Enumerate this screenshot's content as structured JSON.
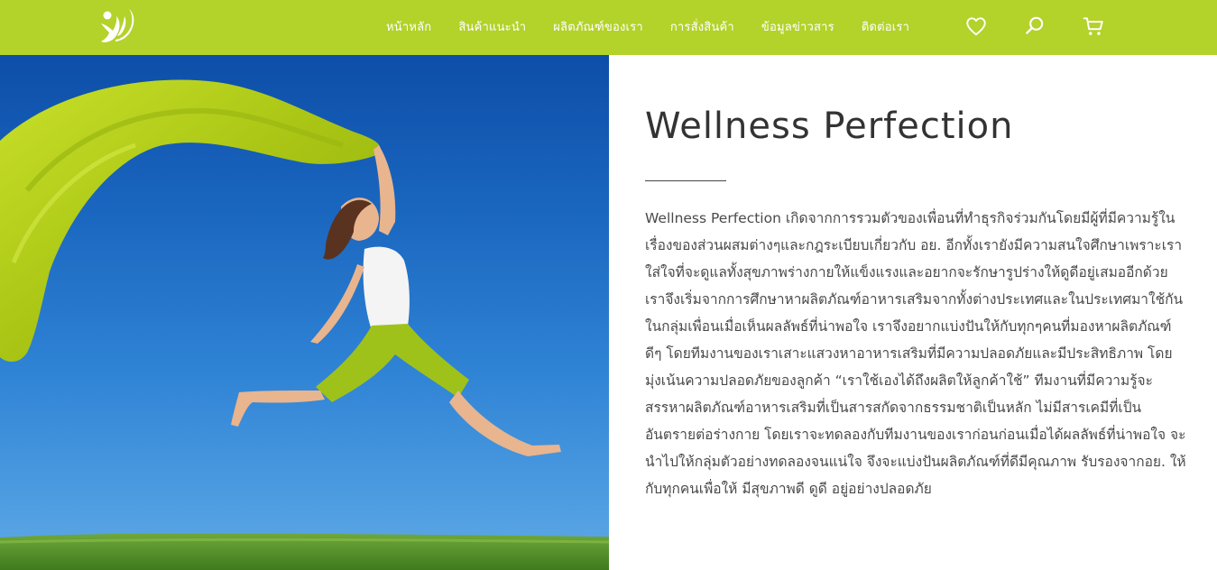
{
  "colors": {
    "brand_green": "#b3d22a",
    "text": "#4a4a4a",
    "heading": "#333333"
  },
  "nav": {
    "items": [
      {
        "label": "หน้าหลัก"
      },
      {
        "label": "สินค้าแนะนำ"
      },
      {
        "label": "ผลิตภัณฑ์ของเรา"
      },
      {
        "label": "การสั่งสินค้า"
      },
      {
        "label": "ข้อมูลข่าวสาร"
      },
      {
        "label": "ติดต่อเรา"
      }
    ],
    "icons": [
      "heart-icon",
      "search-icon",
      "cart-icon"
    ]
  },
  "hero": {
    "image": "woman-leaping-with-green-scarf-photo"
  },
  "about": {
    "title": "Wellness Perfection",
    "description": "Wellness Perfection เกิดจากการรวมตัวของเพื่อนที่ทำธุรกิจร่วมกันโดยมีผู้ที่มีความรู้ในเรื่องของส่วนผสมต่างๆและกฎระเบียบเกี่ยวกับ อย. อีกทั้งเรายังมีความสนใจศึกษาเพราะเราใส่ใจที่จะดูแลทั้งสุขภาพร่างกายให้แข็งแรงและอยากจะรักษารูปร่างให้ดูดีอยู่เสมออีกด้วย เราจึงเริ่มจากการศึกษาหาผลิตภัณฑ์อาหารเสริมจากทั้งต่างประเทศและในประเทศมาใช้กันในกลุ่มเพื่อนเมื่อเห็นผลลัพธ์ที่น่าพอใจ เราจึงอยากแบ่งปันให้กับทุกๆคนที่มองหาผลิตภัณฑ์ดีๆ โดยทีมงานของเราเสาะแสวงหาอาหารเสริมที่มีความปลอดภัยและมีประสิทธิภาพ โดยมุ่งเน้นความปลอดภัยของลูกค้า “เราใช้เองได้ถึงผลิตให้ลูกค้าใช้” ทีมงานที่มีความรู้จะสรรหาผลิตภัณฑ์อาหารเสริมที่เป็นสารสกัดจากธรรมชาติเป็นหลัก ไม่มีสารเคมีที่เป็นอันตรายต่อร่างกาย โดยเราจะทดลองกับทีมงานของเราก่อนก่อนเมื่อได้ผลลัพธ์ที่น่าพอใจ จะนำไปให้กลุ่มตัวอย่างทดลองจนแน่ใจ จึงจะแบ่งปันผลิตภัณฑ์ที่ดีมีคุณภาพ รับรองจากอย. ให้กับทุกคนเพื่อให้ มีสุขภาพดี ดูดี อยู่อย่างปลอดภัย"
  }
}
